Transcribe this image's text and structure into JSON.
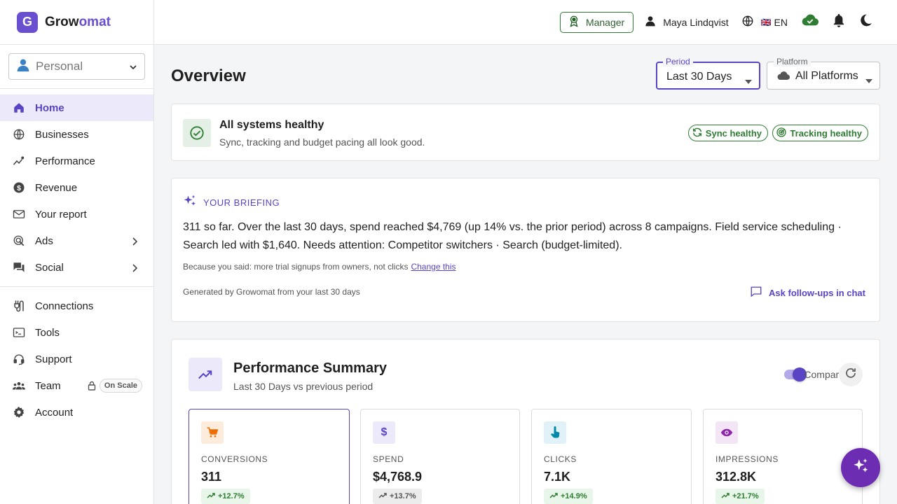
{
  "brand": {
    "logo_letter": "G",
    "name_part1": "Grow",
    "name_part2": "omat"
  },
  "workspace": {
    "label": "Personal",
    "icon": "person-icon"
  },
  "nav": {
    "home": "Home",
    "businesses": "Businesses",
    "performance": "Performance",
    "revenue": "Revenue",
    "report": "Your report",
    "ads": "Ads",
    "social": "Social",
    "connections": "Connections",
    "tools": "Tools",
    "support": "Support",
    "team": "Team",
    "team_badge": "On Scale",
    "account": "Account"
  },
  "topbar": {
    "role": "Manager",
    "user_name": "Maya Lindqvist",
    "flag": "🇬🇧",
    "language": "EN"
  },
  "page": {
    "title": "Overview"
  },
  "filters": {
    "period_label": "Period",
    "period_value": "Last 30 Days",
    "platform_label": "Platform",
    "platform_value": "All Platforms"
  },
  "health": {
    "title": "All systems healthy",
    "subtitle": "Sync, tracking and budget pacing all look good.",
    "chip_sync": "Sync healthy",
    "chip_tracking": "Tracking healthy"
  },
  "briefing": {
    "tag": "YOUR BRIEFING",
    "text": "311 so far. Over the last 30 days, spend reached $4,769 (up 14% vs. the prior period) across 8 campaigns. Field service scheduling · Search led with $1,640. Needs attention: Competitor switchers · Search (budget-limited).",
    "note": "Because you said: more trial signups from owners, not clicks",
    "change_link": "Change this",
    "footer": "Generated by Growomat from your last 30 days",
    "ask": "Ask follow-ups in chat"
  },
  "performance": {
    "title": "Performance Summary",
    "subtitle": "Last 30 Days vs previous period",
    "compare_label": "Compare",
    "compare_on": true,
    "metrics": [
      {
        "label": "CONVERSIONS",
        "value": "311",
        "delta": "+12.7%",
        "icon": "cart-icon"
      },
      {
        "label": "SPEND",
        "value": "$4,768.9",
        "delta": "+13.7%",
        "icon": "dollar-icon"
      },
      {
        "label": "CLICKS",
        "value": "7.1K",
        "delta": "+14.9%",
        "icon": "pointer-icon"
      },
      {
        "label": "IMPRESSIONS",
        "value": "312.8K",
        "delta": "+21.7%",
        "icon": "eye-icon"
      }
    ]
  },
  "colors": {
    "accent": "#5b43c6",
    "healthy": "#2e7d32",
    "fab": "#6d2db2"
  }
}
